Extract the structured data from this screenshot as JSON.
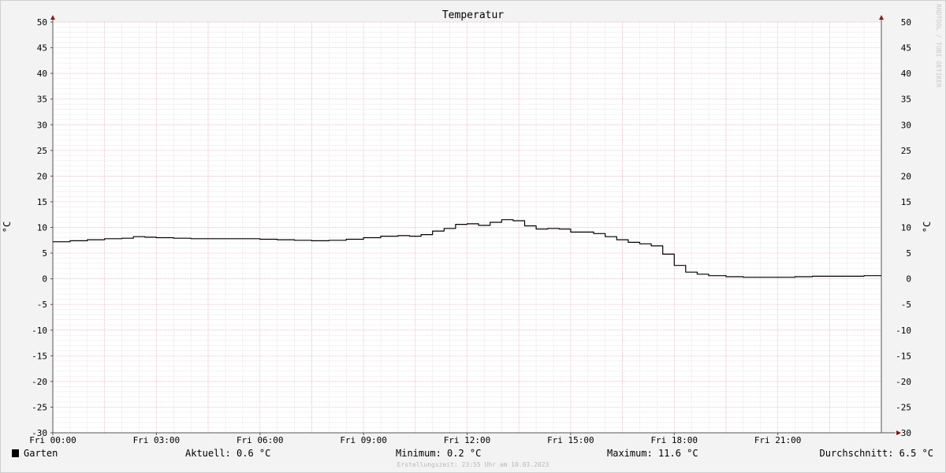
{
  "chart_data": {
    "type": "line",
    "title": "Temperatur",
    "ylabel": "°C",
    "ylim": [
      -30,
      50
    ],
    "y_ticks": [
      "50",
      "45",
      "40",
      "35",
      "30",
      "25",
      "20",
      "15",
      "10",
      "5",
      "0",
      "-5",
      "-10",
      "-15",
      "-20",
      "-25",
      "-30"
    ],
    "xlim": [
      "00:00",
      "24:00"
    ],
    "x_ticks": [
      "Fri 00:00",
      "Fri 03:00",
      "Fri 06:00",
      "Fri 09:00",
      "Fri 12:00",
      "Fri 15:00",
      "Fri 18:00",
      "Fri 21:00"
    ],
    "grid": true,
    "series": [
      {
        "name": "Garten",
        "color": "#000000",
        "x": [
          "00:00",
          "00:30",
          "01:00",
          "01:30",
          "02:00",
          "02:20",
          "02:40",
          "03:00",
          "03:30",
          "04:00",
          "04:30",
          "05:00",
          "05:30",
          "06:00",
          "06:30",
          "07:00",
          "07:30",
          "08:00",
          "08:30",
          "09:00",
          "09:30",
          "10:00",
          "10:20",
          "10:40",
          "11:00",
          "11:20",
          "11:40",
          "12:00",
          "12:20",
          "12:40",
          "13:00",
          "13:20",
          "13:40",
          "14:00",
          "14:20",
          "14:40",
          "15:00",
          "15:20",
          "15:40",
          "16:00",
          "16:20",
          "16:40",
          "17:00",
          "17:20",
          "17:40",
          "18:00",
          "18:20",
          "18:40",
          "19:00",
          "19:30",
          "20:00",
          "20:30",
          "21:00",
          "21:30",
          "22:00",
          "22:30",
          "23:00",
          "23:30",
          "24:00"
        ],
        "y": [
          7.2,
          7.4,
          7.6,
          7.8,
          7.9,
          8.2,
          8.1,
          8.0,
          7.9,
          7.8,
          7.8,
          7.8,
          7.8,
          7.7,
          7.6,
          7.5,
          7.4,
          7.5,
          7.7,
          8.0,
          8.3,
          8.4,
          8.3,
          8.6,
          9.3,
          9.8,
          10.6,
          10.7,
          10.4,
          11.0,
          11.5,
          11.3,
          10.3,
          9.7,
          9.8,
          9.7,
          9.1,
          9.1,
          8.8,
          8.2,
          7.6,
          7.1,
          6.8,
          6.4,
          4.8,
          2.6,
          1.3,
          0.9,
          0.6,
          0.4,
          0.3,
          0.3,
          0.3,
          0.4,
          0.5,
          0.5,
          0.5,
          0.6,
          0.6
        ]
      }
    ]
  },
  "legend": {
    "series_name": "Garten",
    "aktuell": "Aktuell: 0.6 °C",
    "minimum": "Minimum: 0.2 °C",
    "maximum": "Maximum: 11.6 °C",
    "durchschnitt": "Durchschnitt: 6.5 °C"
  },
  "footer": "Erstellungszeit: 23:55 Uhr am 10.03.2023",
  "watermark": "RRDTOOL / TOBI OETIKER",
  "colors": {
    "major_grid": "#e8a7b3",
    "minor_grid": "#d9d9d9",
    "axis": "#555555",
    "arrow": "#8b1a1a",
    "line": "#000000"
  }
}
